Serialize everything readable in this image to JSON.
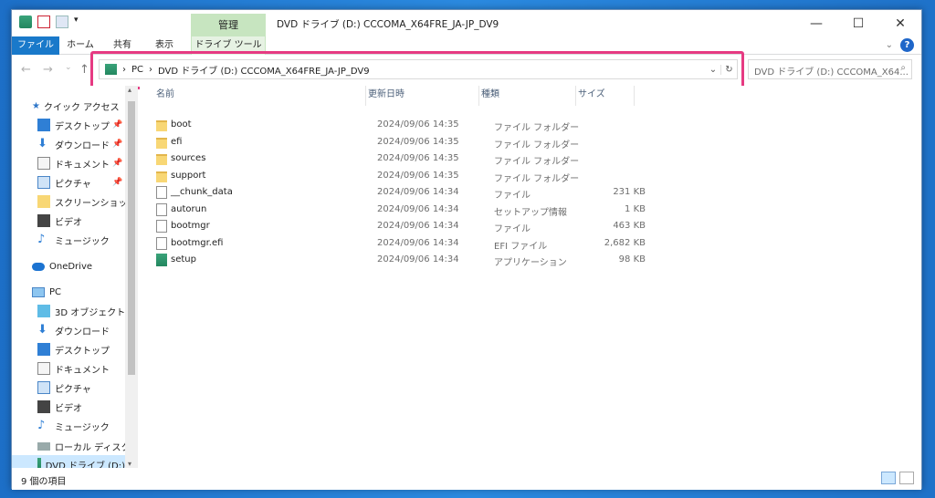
{
  "window": {
    "title": "DVD ドライブ (D:) CCCOMA_X64FRE_JA-JP_DV9",
    "manage_tab": "管理",
    "controls": {
      "minimize": "—",
      "maximize": "☐",
      "close": "✕"
    }
  },
  "ribbon": {
    "tabs": [
      "ファイル",
      "ホーム",
      "共有",
      "表示",
      "ドライブ ツール"
    ],
    "help": "?"
  },
  "address": {
    "crumbs": [
      "PC",
      "DVD ドライブ (D:) CCCOMA_X64FRE_JA-JP_DV9"
    ],
    "search_placeholder": "DVD ドライブ (D:) CCCOMA_X64..."
  },
  "nav": {
    "quick_access": "クイック アクセス",
    "quick_items": [
      "デスクトップ",
      "ダウンロード",
      "ドキュメント",
      "ピクチャ",
      "スクリーンショット",
      "ビデオ",
      "ミュージック"
    ],
    "onedrive": "OneDrive",
    "pc": "PC",
    "pc_items": [
      "3D オブジェクト",
      "ダウンロード",
      "デスクトップ",
      "ドキュメント",
      "ピクチャ",
      "ビデオ",
      "ミュージック",
      "ローカル ディスク (C",
      "DVD ドライブ (D:)"
    ]
  },
  "columns": {
    "name": "名前",
    "date": "更新日時",
    "type": "種類",
    "size": "サイズ"
  },
  "files": [
    {
      "name": "boot",
      "date": "2024/09/06 14:35",
      "type": "ファイル フォルダー",
      "size": "",
      "kind": "folder"
    },
    {
      "name": "efi",
      "date": "2024/09/06 14:35",
      "type": "ファイル フォルダー",
      "size": "",
      "kind": "folder"
    },
    {
      "name": "sources",
      "date": "2024/09/06 14:35",
      "type": "ファイル フォルダー",
      "size": "",
      "kind": "folder"
    },
    {
      "name": "support",
      "date": "2024/09/06 14:35",
      "type": "ファイル フォルダー",
      "size": "",
      "kind": "folder"
    },
    {
      "name": "__chunk_data",
      "date": "2024/09/06 14:34",
      "type": "ファイル",
      "size": "231 KB",
      "kind": "doc"
    },
    {
      "name": "autorun",
      "date": "2024/09/06 14:34",
      "type": "セットアップ情報",
      "size": "1 KB",
      "kind": "doc"
    },
    {
      "name": "bootmgr",
      "date": "2024/09/06 14:34",
      "type": "ファイル",
      "size": "463 KB",
      "kind": "doc"
    },
    {
      "name": "bootmgr.efi",
      "date": "2024/09/06 14:34",
      "type": "EFI ファイル",
      "size": "2,682 KB",
      "kind": "doc"
    },
    {
      "name": "setup",
      "date": "2024/09/06 14:34",
      "type": "アプリケーション",
      "size": "98 KB",
      "kind": "app"
    }
  ],
  "status": {
    "count": "9 個の項目"
  }
}
